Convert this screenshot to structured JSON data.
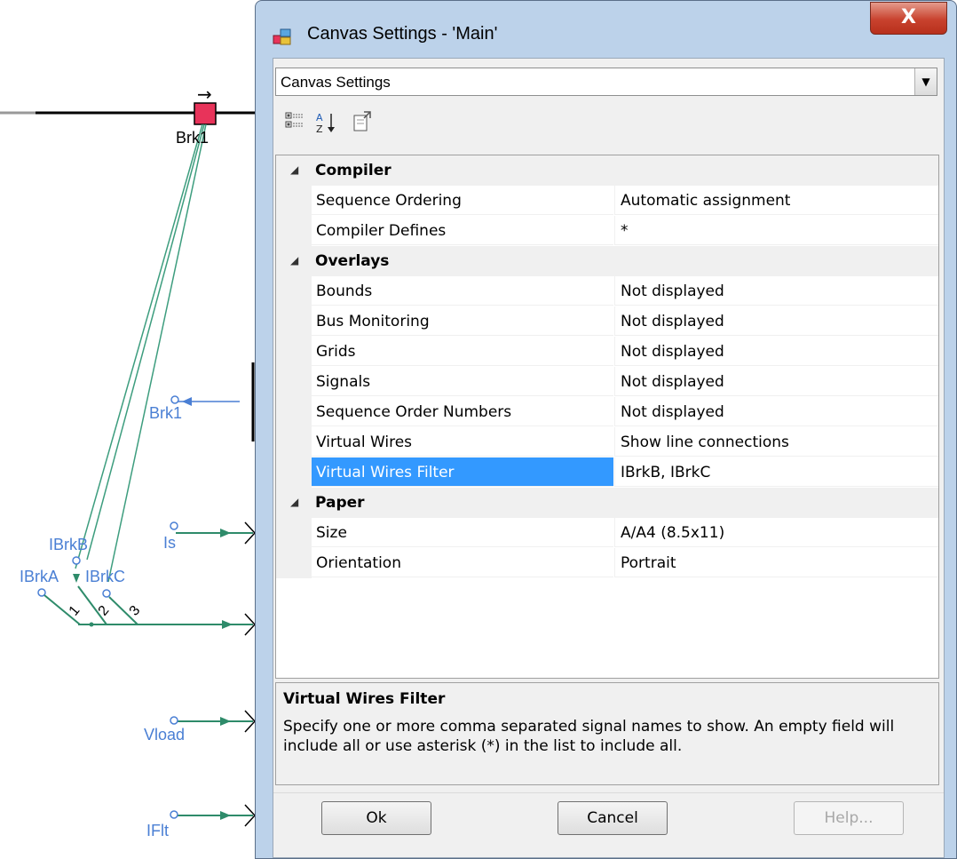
{
  "schematic": {
    "breaker_label": "Brk1",
    "arrow_glyph": "→",
    "labels": {
      "brk1_signal": "Brk1",
      "is": "Is",
      "ibrkb": "IBrkB",
      "ibrka": "IBrkA",
      "ibrkc": "IBrkC",
      "num1": "1",
      "num2": "2",
      "num3": "3",
      "vload": "Vload",
      "iflt": "IFlt"
    }
  },
  "dialog": {
    "title": "Canvas Settings - 'Main'",
    "close_glyph": "X",
    "combo_value": "Canvas Settings",
    "toolbar": {
      "categorized_icon": "categorized-icon",
      "alphabetical_icon": "alphabetical-sort-icon",
      "property_pages_icon": "property-pages-icon"
    },
    "categories": [
      {
        "label": "Compiler",
        "properties": [
          {
            "name": "Sequence Ordering",
            "value": "Automatic assignment"
          },
          {
            "name": "Compiler Defines",
            "value": "*"
          }
        ]
      },
      {
        "label": "Overlays",
        "properties": [
          {
            "name": "Bounds",
            "value": "Not displayed"
          },
          {
            "name": "Bus Monitoring",
            "value": "Not displayed"
          },
          {
            "name": "Grids",
            "value": "Not displayed"
          },
          {
            "name": "Signals",
            "value": "Not displayed"
          },
          {
            "name": "Sequence Order Numbers",
            "value": "Not displayed"
          },
          {
            "name": "Virtual Wires",
            "value": "Show line connections"
          },
          {
            "name": "Virtual Wires Filter",
            "value": "IBrkB, IBrkC"
          }
        ]
      },
      {
        "label": "Paper",
        "properties": [
          {
            "name": "Size",
            "value": "A/A4 (8.5x11)"
          },
          {
            "name": "Orientation",
            "value": "Portrait"
          }
        ]
      }
    ],
    "selected_property": "Virtual Wires Filter",
    "help": {
      "title": "Virtual Wires Filter",
      "description": "Specify one or more comma separated signal names to show. An empty field will include all or use asterisk (*) in the list to include all."
    },
    "buttons": {
      "ok": "Ok",
      "cancel": "Cancel",
      "help": "Help..."
    },
    "colors": {
      "selection": "#3399ff",
      "close_button": "#c8422e",
      "wire_green": "#2e8b6a",
      "signal_blue": "#4a7fd4",
      "breaker_red": "#e8335a"
    }
  }
}
